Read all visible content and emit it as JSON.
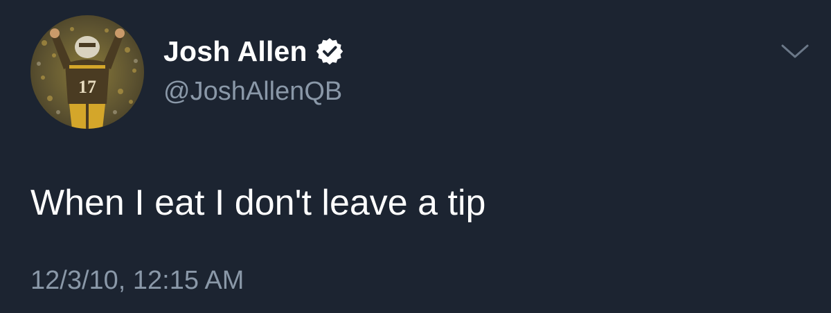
{
  "tweet": {
    "display_name": "Josh Allen",
    "handle": "@JoshAllenQB",
    "text": "When I eat I don't leave a tip",
    "timestamp": "12/3/10, 12:15 AM",
    "avatar_jersey_number": "17"
  },
  "icons": {
    "verified": "verified-badge-icon",
    "menu": "chevron-down-icon"
  },
  "colors": {
    "background": "#1c2431",
    "name": "#ffffff",
    "secondary_text": "#8a98a8",
    "jersey": "#4a3b22",
    "jersey_accent": "#d4a62a"
  }
}
